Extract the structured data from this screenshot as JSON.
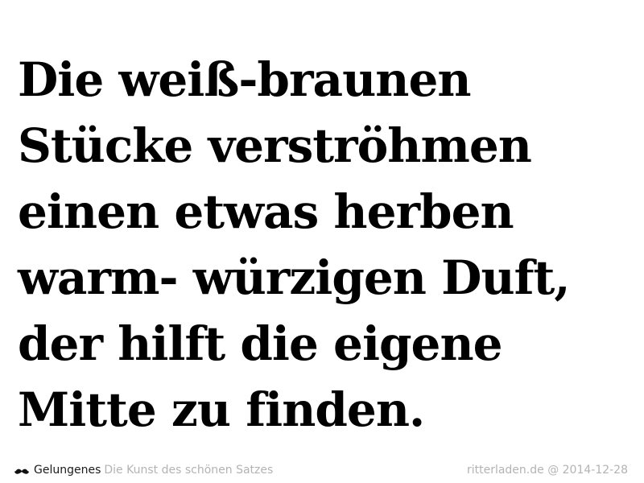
{
  "quote": {
    "lines": [
      "Die weiß-braunen",
      "Stücke verströhmen",
      "einen etwas herben",
      "warm- würzigen Duft,",
      "der hilft die eigene",
      "Mitte zu finden."
    ]
  },
  "footer": {
    "brand_icon": "mustache-icon",
    "brand_name": "Gelungenes",
    "tagline": "Die Kunst des schönen Satzes",
    "source": "ritterladen.de @ 2014-12-28"
  }
}
